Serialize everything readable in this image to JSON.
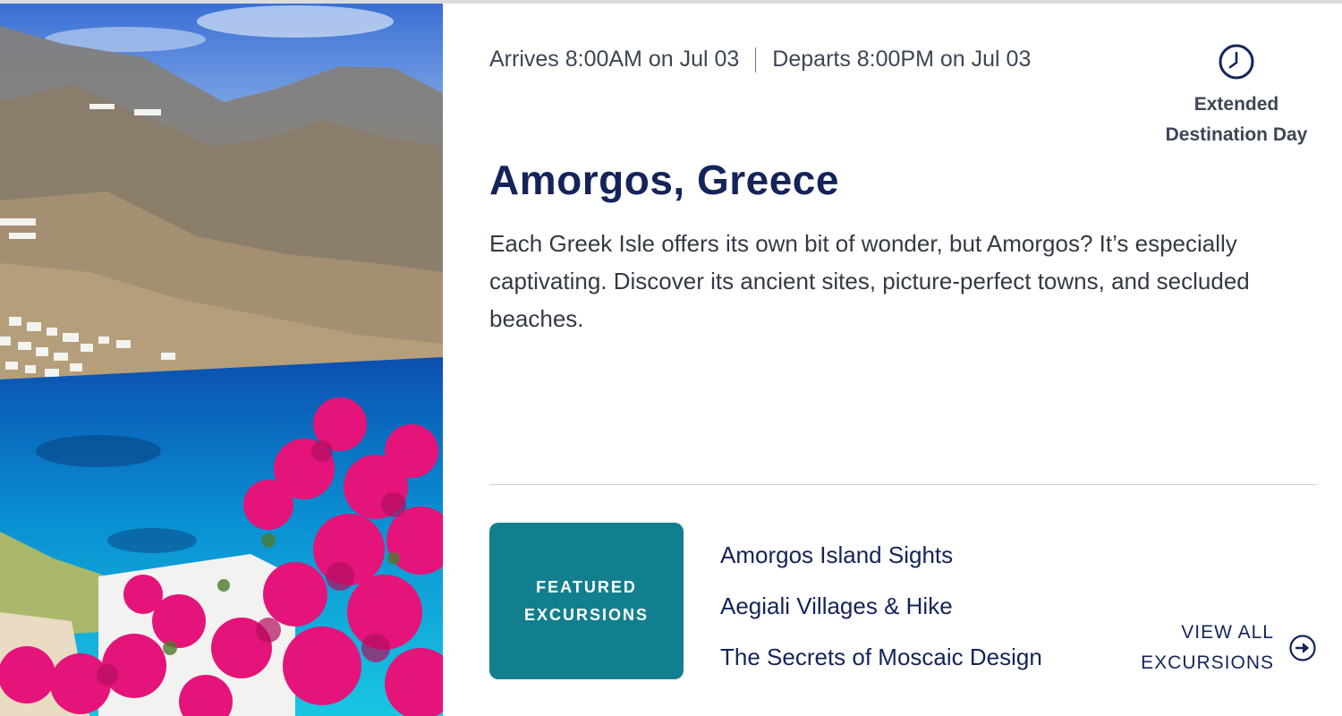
{
  "port": {
    "arrival": "Arrives 8:00AM on Jul 03",
    "departure": "Departs 8:00PM on Jul 03",
    "badge": {
      "icon": "clock-icon",
      "line1": "Extended",
      "line2": "Destination Day"
    },
    "title": "Amorgos, Greece",
    "description": "Each Greek Isle offers its own bit of wonder, but Amorgos? It’s especially captivating. Discover its ancient sites, picture-perfect towns, and secluded beaches."
  },
  "featured": {
    "line1": "FEATURED",
    "line2": "EXCURSIONS",
    "items": [
      "Amorgos Island Sights",
      "Aegiali Villages & Hike",
      "The Secrets of Moscaic Design"
    ],
    "view_all_line1": "VIEW ALL",
    "view_all_line2": "EXCURSIONS",
    "view_all_icon": "arrow-right-circle-icon"
  },
  "colors": {
    "navy": "#14245a",
    "teal": "#127f8f",
    "text": "#333a44"
  }
}
